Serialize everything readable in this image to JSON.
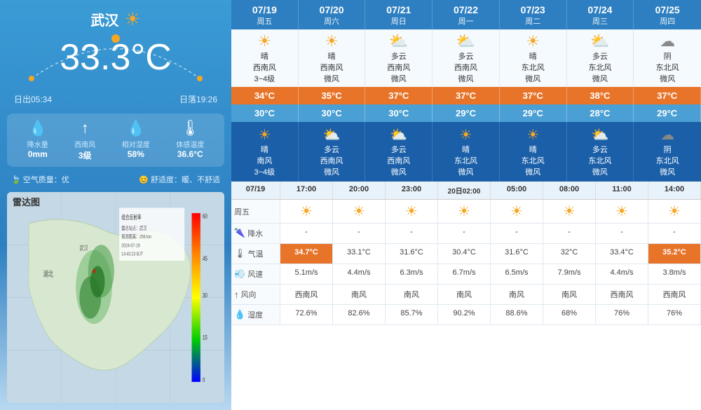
{
  "left": {
    "city": "武汉",
    "temperature": "33.3°C",
    "sunrise": "日出05:34",
    "sunset": "日落19:26",
    "details": [
      {
        "icon": "💧",
        "label": "降水量",
        "value": "0mm"
      },
      {
        "icon": "↑",
        "label": "西南风",
        "value": "3级"
      },
      {
        "icon": "💧",
        "label": "相对湿度",
        "value": "58%"
      },
      {
        "icon": "🌡",
        "label": "体感温度",
        "value": "36.6°C"
      }
    ],
    "airQuality": "空气质量：优",
    "comfort": "舒适度：暖、不舒适",
    "radarTitle": "雷达图"
  },
  "forecast": {
    "days": [
      {
        "date": "07/19",
        "dayName": "周五"
      },
      {
        "date": "07/20",
        "dayName": "周六"
      },
      {
        "date": "07/21",
        "dayName": "周日"
      },
      {
        "date": "07/22",
        "dayName": "周一"
      },
      {
        "date": "07/23",
        "dayName": "周二"
      },
      {
        "date": "07/24",
        "dayName": "周三"
      },
      {
        "date": "07/25",
        "dayName": "周四"
      }
    ],
    "dayWeather": [
      {
        "icon": "☀",
        "desc": "晴",
        "wind": "西南风",
        "level": "3~4级"
      },
      {
        "icon": "☀",
        "desc": "晴",
        "wind": "西南风",
        "level": "微风"
      },
      {
        "icon": "⛅",
        "desc": "多云",
        "wind": "西南风",
        "level": "微风"
      },
      {
        "icon": "⛅",
        "desc": "多云",
        "wind": "西南风",
        "level": "微风"
      },
      {
        "icon": "☀",
        "desc": "晴",
        "wind": "东北风",
        "level": "微风"
      },
      {
        "icon": "⛅",
        "desc": "多云",
        "wind": "东北风",
        "level": "微风"
      },
      {
        "icon": "☁",
        "desc": "阴",
        "wind": "东北风",
        "level": "微风"
      }
    ],
    "highTemps": [
      "34°C",
      "35°C",
      "37°C",
      "37°C",
      "37°C",
      "38°C",
      "37°C"
    ],
    "lowTemps": [
      "30°C",
      "30°C",
      "30°C",
      "29°C",
      "29°C",
      "28°C",
      "29°C"
    ],
    "nightWeather": [
      {
        "icon": "☀",
        "desc": "晴",
        "wind": "南风",
        "level": "3~4级"
      },
      {
        "icon": "⛅",
        "desc": "多云",
        "wind": "西南风",
        "level": "微风"
      },
      {
        "icon": "⛅",
        "desc": "多云",
        "wind": "西南风",
        "level": "微风"
      },
      {
        "icon": "☀",
        "desc": "晴",
        "wind": "东北风",
        "level": "微风"
      },
      {
        "icon": "☀",
        "desc": "晴",
        "wind": "东北风",
        "level": "微风"
      },
      {
        "icon": "⛅",
        "desc": "多云",
        "wind": "东北风",
        "level": "微风"
      },
      {
        "icon": "☁",
        "desc": "阴",
        "wind": "东北风",
        "level": "微风"
      }
    ]
  },
  "hourly": {
    "dateLabel": "07/19",
    "dateLabel2": "20日02:00",
    "times": [
      "17:00",
      "20:00",
      "23:00",
      "20日02:00",
      "05:00",
      "08:00",
      "11:00",
      "14:00"
    ],
    "dayLabel": "周五",
    "icons": [
      "☀",
      "☀",
      "☀",
      "☀",
      "☀",
      "☀",
      "☀",
      "☀"
    ],
    "precipitation": [
      "-",
      "-",
      "-",
      "-",
      "-",
      "-",
      "-",
      "-"
    ],
    "temperature": [
      "34.7°C",
      "33.1°C",
      "31.6°C",
      "30.4°C",
      "31.6°C",
      "32°C",
      "33.4°C",
      "35.2°C"
    ],
    "windSpeed": [
      "5.1m/s",
      "4.4m/s",
      "6.3m/s",
      "6.7m/s",
      "6.5m/s",
      "7.9m/s",
      "4.4m/s",
      "3.8m/s"
    ],
    "windDir": [
      "西南风",
      "南风",
      "南风",
      "南风",
      "南风",
      "南风",
      "西南风",
      "西南风"
    ],
    "humidity": [
      "72.6%",
      "82.6%",
      "85.7%",
      "90.2%",
      "88.6%",
      "68%",
      "76%",
      "76%"
    ],
    "labels": {
      "precipitation": "降水",
      "temperature": "气温",
      "windSpeed": "风速",
      "windDir": "风向",
      "humidity": "湿度"
    }
  }
}
